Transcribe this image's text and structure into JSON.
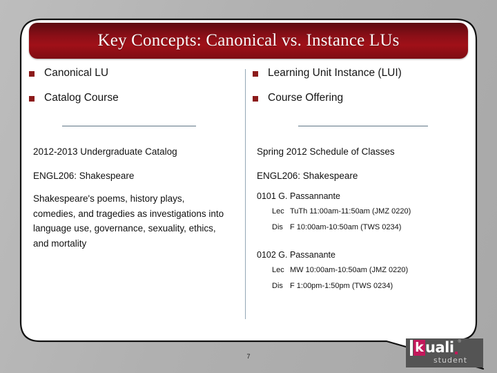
{
  "slide": {
    "title": "Key Concepts: Canonical vs. Instance LUs",
    "page_number": "7",
    "accent_color": "#8c1a1a",
    "banner_color": "#8c0f17",
    "background_color": "#b3b3b3"
  },
  "columns": {
    "left": {
      "bullets": [
        {
          "label": "Canonical LU"
        },
        {
          "label": "Catalog Course"
        }
      ],
      "source": "2012-2013 Undergraduate Catalog",
      "course": "ENGL206: Shakespeare",
      "description": "Shakespeare's poems, history plays, comedies, and tragedies as investigations into language use, governance, sexuality, ethics, and mortality"
    },
    "right": {
      "bullets": [
        {
          "label": "Learning Unit Instance (LUI)"
        },
        {
          "label": "Course Offering"
        }
      ],
      "source": "Spring 2012 Schedule of Classes",
      "course": "ENGL206: Shakespeare",
      "sections": [
        {
          "heading": "0101 G. Passannante",
          "meetings": [
            {
              "type": "Lec",
              "detail": "TuTh 11:00am-11:50am (JMZ 0220)"
            },
            {
              "type": "Dis",
              "detail": "F 10:00am-10:50am (TWS 0234)"
            }
          ]
        },
        {
          "heading": "0102 G. Passanante",
          "meetings": [
            {
              "type": "Lec",
              "detail": "MW 10:00am-10:50am (JMZ 0220)"
            },
            {
              "type": "Dis",
              "detail": "F 1:00pm-1:50pm (TWS 0234)"
            }
          ]
        }
      ]
    }
  },
  "logo": {
    "word": "uali",
    "sub": "student",
    "registered": "®",
    "mark_letter": "k",
    "mark_color": "#c2185b",
    "box_color": "#545454"
  }
}
